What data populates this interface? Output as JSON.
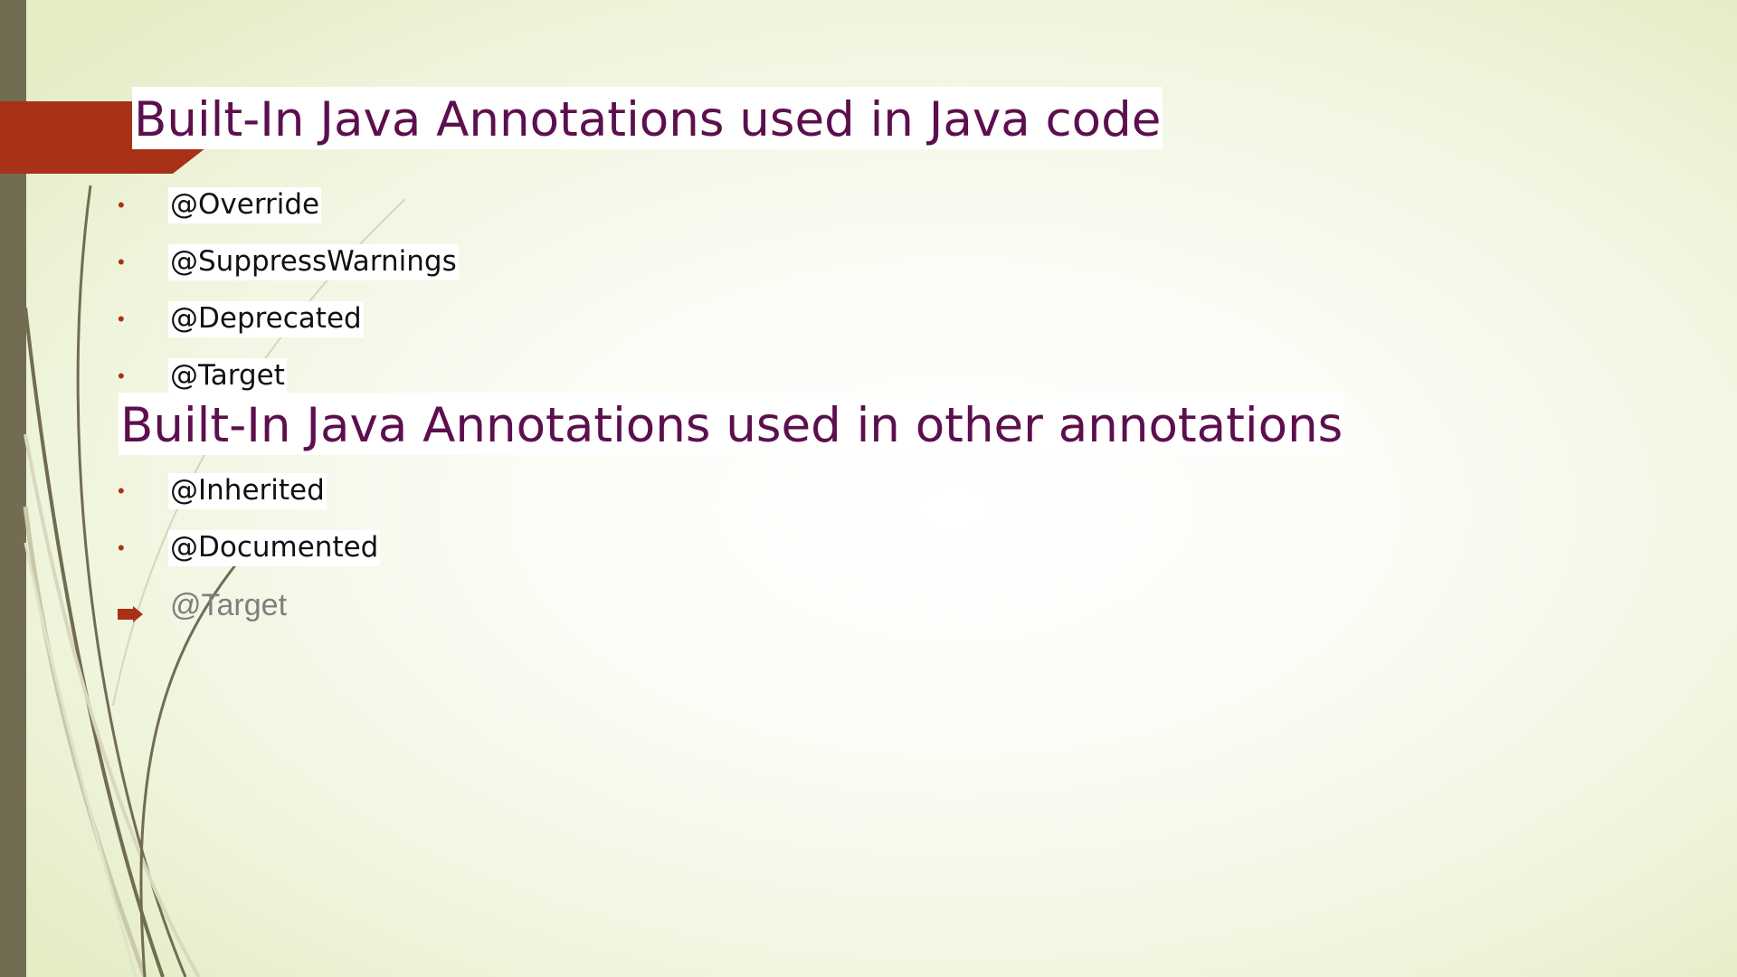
{
  "slide": {
    "sections": [
      {
        "heading": "Built-In Java Annotations used in Java code",
        "items": [
          "@Override",
          "@SuppressWarnings",
          "@Deprecated",
          "@Target"
        ]
      },
      {
        "heading": "Built-In Java Annotations used in other annotations",
        "items": [
          "@Inherited",
          "@Documented",
          "@Target"
        ]
      }
    ]
  },
  "colors": {
    "heading": "#5d0f4d",
    "accent": "#a93117",
    "side_bar": "#716c52",
    "background": "#eff4dc"
  },
  "icons": {
    "bullet": "dot-bullet-icon",
    "last_bullet": "arrow-bullet-icon"
  }
}
